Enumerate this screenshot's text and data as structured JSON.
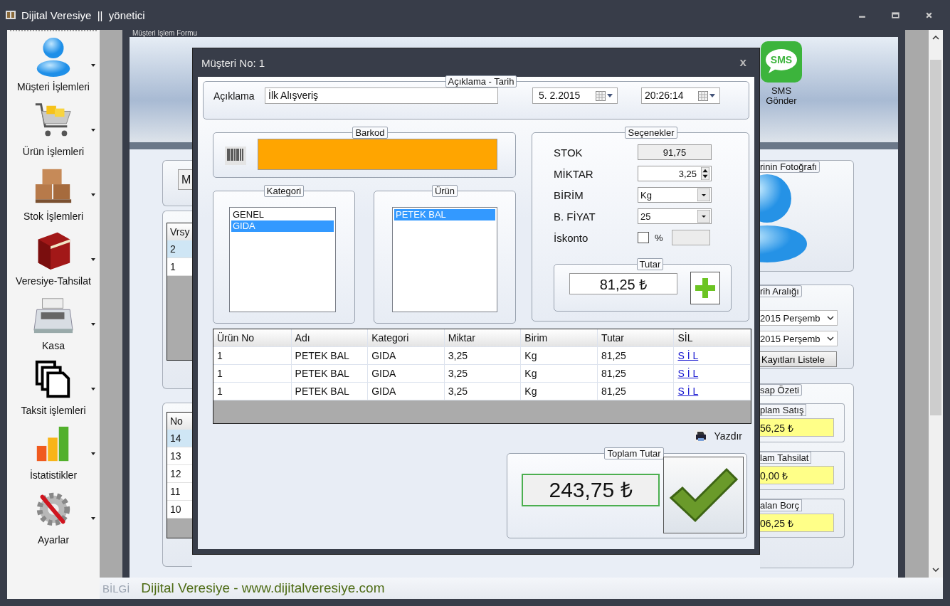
{
  "app": {
    "title": "Dijital Veresiye  ||  yönetici"
  },
  "sidebar": {
    "items": [
      {
        "label": "Müşteri İşlemleri",
        "kind": "person"
      },
      {
        "label": "Ürün İşlemleri",
        "kind": "cart"
      },
      {
        "label": "Stok İşlemleri",
        "kind": "boxes"
      },
      {
        "label": "Veresiye-Tahsilat",
        "kind": "book"
      },
      {
        "label": "Kasa",
        "kind": "register"
      },
      {
        "label": "Taksit işlemleri",
        "kind": "pages"
      },
      {
        "label": "İstatistikler",
        "kind": "chart"
      },
      {
        "label": "Ayarlar",
        "kind": "gear"
      }
    ]
  },
  "form": {
    "title": "Müşteri İşlem Formu",
    "toolbar": {
      "label_1": "SMS",
      "label_2": "Gönder",
      "icon_text": "SMS"
    },
    "search_value": "M",
    "table_1": {
      "columns": [
        "Vrsy"
      ],
      "rows": [
        {
          "cells": [
            "2"
          ],
          "selected": true
        },
        {
          "cells": [
            "1"
          ],
          "selected": false
        }
      ]
    },
    "table_2": {
      "columns": [
        "No"
      ],
      "rows": [
        {
          "cells": [
            "14"
          ],
          "selected": true
        },
        {
          "cells": [
            "13"
          ],
          "selected": false
        },
        {
          "cells": [
            "12"
          ],
          "selected": false
        },
        {
          "cells": [
            "11"
          ],
          "selected": false
        },
        {
          "cells": [
            "10"
          ],
          "selected": false
        }
      ]
    },
    "photo": {
      "title": "rinin Fotoğrafı"
    },
    "date_range": {
      "title": "rih Aralığı",
      "dropdowns": [
        "2015 Perşemb",
        "2015 Perşemb"
      ],
      "button": "Kayıtları Listele"
    },
    "summary": {
      "title": "sap Özeti",
      "items": [
        {
          "label": "plam Satış",
          "value": "56,25 ₺"
        },
        {
          "label": "lam Tahsilat",
          "value": "0,00 ₺"
        },
        {
          "label": "alan Borç",
          "value": "06,25 ₺"
        }
      ]
    }
  },
  "status_bar": {
    "label": "BİLGİ",
    "text": "Dijital Veresiye - www.dijitalveresiye.com"
  },
  "dialog": {
    "title": "Müşteri No: 1",
    "close": "x",
    "description_group": {
      "title": "Açıklama - Tarih",
      "label": "Açıklama",
      "value": "İlk Alışveriş",
      "date": "5.  2.2015",
      "time": "20:26:14"
    },
    "barcode": {
      "title": "Barkod"
    },
    "category": {
      "title": "Kategori",
      "items": [
        {
          "label": "GENEL",
          "selected": false
        },
        {
          "label": "GIDA",
          "selected": true
        }
      ]
    },
    "product": {
      "title": "Ürün",
      "items": [
        {
          "label": "PETEK BAL",
          "selected": true
        }
      ]
    },
    "options": {
      "title": "Seçenekler",
      "stock_label": "STOK",
      "stock": "91,75",
      "quantity_label": "MİKTAR",
      "quantity": "3,25",
      "unit_label": "BİRİM",
      "unit": "Kg",
      "price_label": "B. FİYAT",
      "price": "25",
      "discount_label": "İskonto",
      "discount_checked": false,
      "percent": "%",
      "total_title": "Tutar",
      "total": "81,25 ₺"
    },
    "items_table": {
      "columns": [
        "Ürün No",
        "Adı",
        "Kategori",
        "Miktar",
        "Birim",
        "Tutar",
        "SİL"
      ],
      "rows": [
        {
          "cells": [
            "1",
            "PETEK BAL",
            "GIDA",
            "3,25",
            "Kg",
            "81,25"
          ],
          "link": "S İ L"
        },
        {
          "cells": [
            "1",
            "PETEK BAL",
            "GIDA",
            "3,25",
            "Kg",
            "81,25"
          ],
          "link": "S İ L"
        },
        {
          "cells": [
            "1",
            "PETEK BAL",
            "GIDA",
            "3,25",
            "Kg",
            "81,25"
          ],
          "link": "S İ L"
        }
      ]
    },
    "print": "Yazdır",
    "grand_total": {
      "title": "Toplam Tutar",
      "value": "243,75 ₺"
    }
  }
}
